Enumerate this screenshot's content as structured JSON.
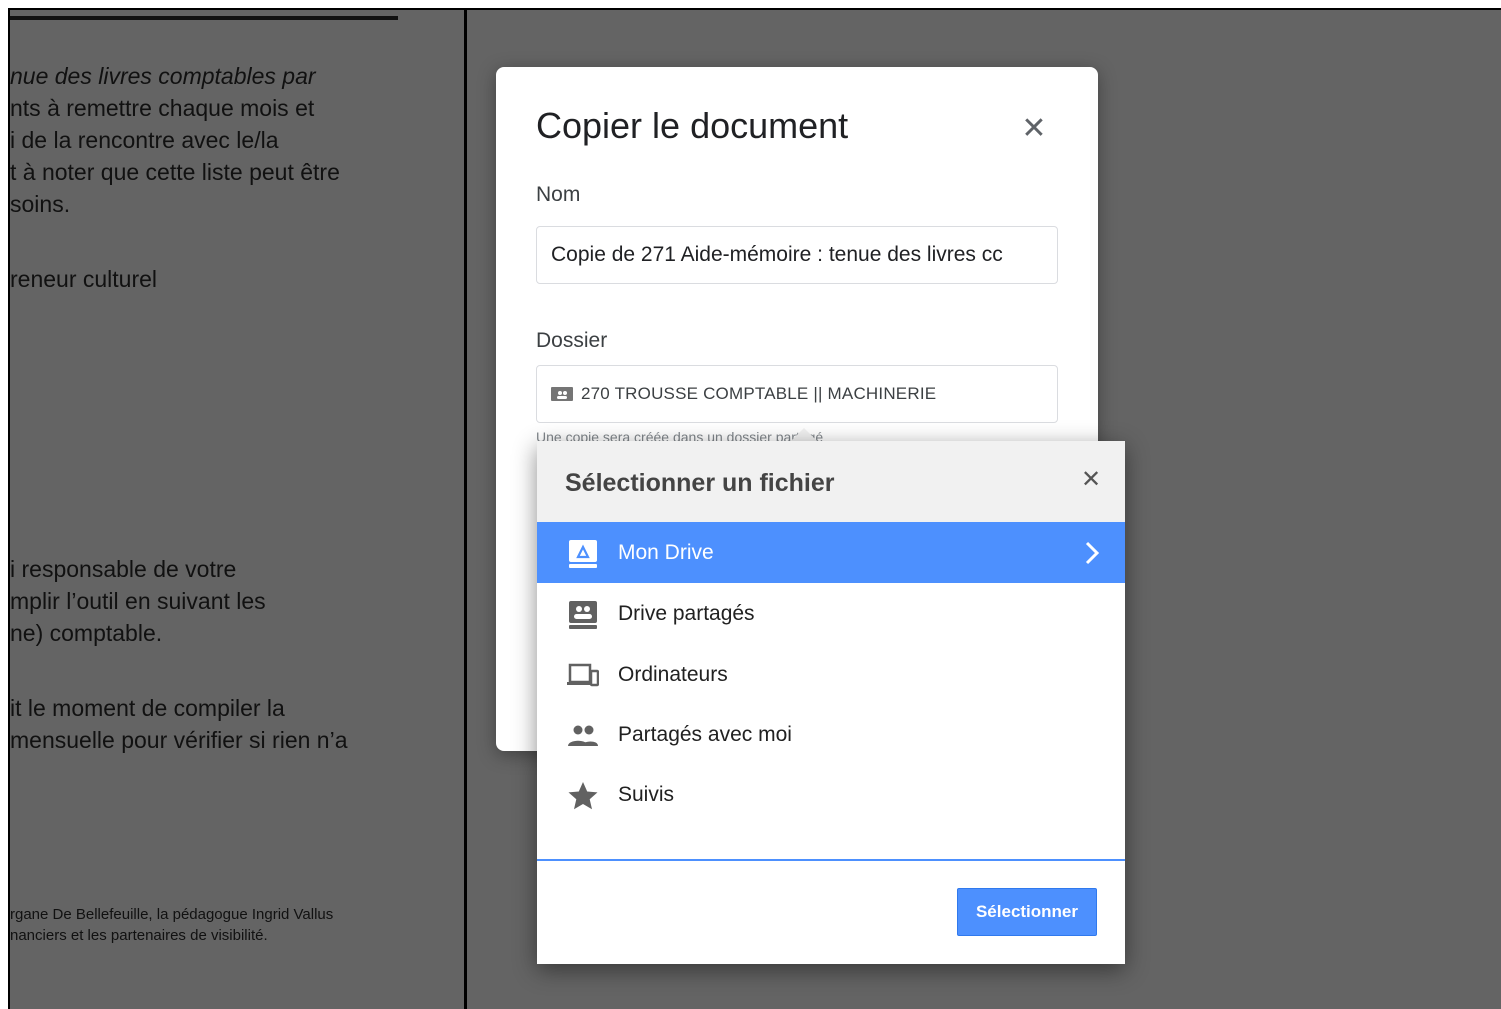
{
  "background_doc": {
    "lines": [
      "nue des livres comptables par",
      "nts à remettre chaque mois et",
      "i de la rencontre avec le/la",
      "t à noter que cette liste peut être",
      "soins.",
      "reneur culturel",
      "i responsable de votre",
      "mplir l’outil en suivant les",
      "ne) comptable.",
      "it le moment de compiler la",
      "mensuelle pour vérifier si rien n’a"
    ],
    "footer_lines": [
      "rgane De Bellefeuille, la pédagogue Ingrid Vallus",
      "nanciers et les partenaires de visibilité."
    ]
  },
  "copy_dialog": {
    "title": "Copier le document",
    "name_label": "Nom",
    "name_value": "Copie de 271 Aide-mémoire : tenue des livres cc",
    "folder_label": "Dossier",
    "folder_value": "270 TROUSSE COMPTABLE || MACHINERIE",
    "hint": "Une copie sera créée dans un dossier partagé"
  },
  "picker": {
    "title": "Sélectionner un fichier",
    "items": [
      {
        "label": "Mon Drive",
        "icon": "my-drive-icon",
        "selected": true
      },
      {
        "label": "Drive partagés",
        "icon": "shared-drives-icon"
      },
      {
        "label": "Ordinateurs",
        "icon": "computers-icon"
      },
      {
        "label": "Partagés avec moi",
        "icon": "shared-with-me-icon"
      },
      {
        "label": "Suivis",
        "icon": "star-icon"
      }
    ],
    "select_label": "Sélectionner"
  },
  "colors": {
    "accent": "#4d90fe",
    "overlay": "#646464"
  }
}
